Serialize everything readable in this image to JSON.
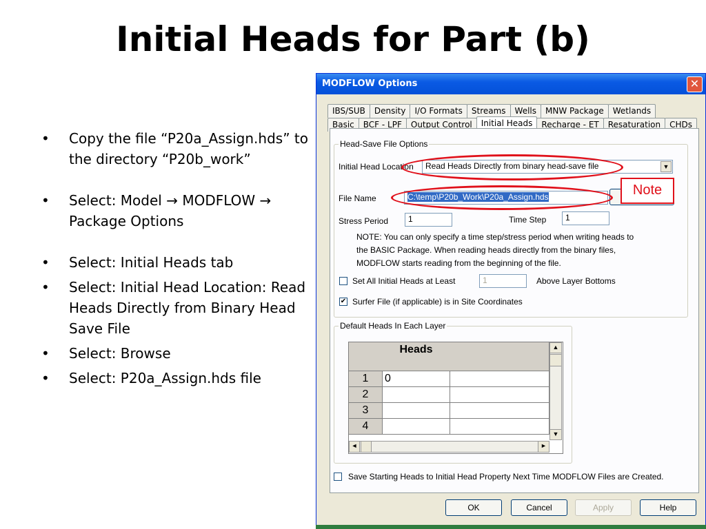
{
  "slide": {
    "title": "Initial Heads for Part (b)",
    "bullets": [
      "Copy the file “P20a_Assign.hds” to the directory “P20b_work”",
      "Select: Model → MODFLOW → Package Options",
      "Select: Initial Heads tab",
      "Select: Initial Head Location: Read Heads Directly from Binary Head Save File",
      "Select: Browse",
      "Select: P20a_Assign.hds file"
    ],
    "bullet_glyph": "•"
  },
  "dialog": {
    "title": "MODFLOW Options",
    "close_glyph": "✕",
    "tabs_row1": [
      "IBS/SUB",
      "Density",
      "I/O Formats",
      "Streams",
      "Wells",
      "MNW Package",
      "Wetlands"
    ],
    "tabs_row2": [
      "Basic",
      "BCF - LPF",
      "Output Control",
      "Initial Heads",
      "Recharge - ET",
      "Resaturation",
      "CHDs"
    ],
    "active_tab": "Initial Heads",
    "head_save": {
      "legend": "Head-Save File Options",
      "location_label": "Initial Head Location",
      "location_value": "Read Heads Directly from binary head-save file",
      "file_name_label": "File Name",
      "file_name_value": "C:\\temp\\P20b_Work\\P20a_Assign.hds",
      "stress_period_label": "Stress Period",
      "stress_period_value": "1",
      "time_step_label": "Time Step",
      "time_step_value": "1",
      "note_lines": [
        "NOTE: You can only specify a time step/stress period when writing heads to",
        "the BASIC Package.  When reading heads directly from the binary files,",
        "MODFLOW starts reading from the beginning of the file."
      ],
      "set_all_label": "Set All Initial Heads at Least",
      "set_all_checked": false,
      "set_all_value": "1",
      "above_label": "Above Layer Bottoms",
      "surfer_label": "Surfer File (if applicable) is in Site Coordinates",
      "surfer_checked": true
    },
    "default_heads": {
      "legend": "Default Heads In Each Layer",
      "column_header": "Heads",
      "rows": [
        {
          "label": "1",
          "value": "0"
        },
        {
          "label": "2",
          "value": ""
        },
        {
          "label": "3",
          "value": ""
        },
        {
          "label": "4",
          "value": ""
        }
      ]
    },
    "save_starting_label": "Save Starting Heads to Initial Head Property Next Time MODFLOW Files are Created.",
    "save_starting_checked": false,
    "buttons": {
      "ok": "OK",
      "cancel": "Cancel",
      "apply": "Apply",
      "help": "Help"
    }
  },
  "callout": {
    "note_label": "Note",
    "color": "#e0101a"
  }
}
